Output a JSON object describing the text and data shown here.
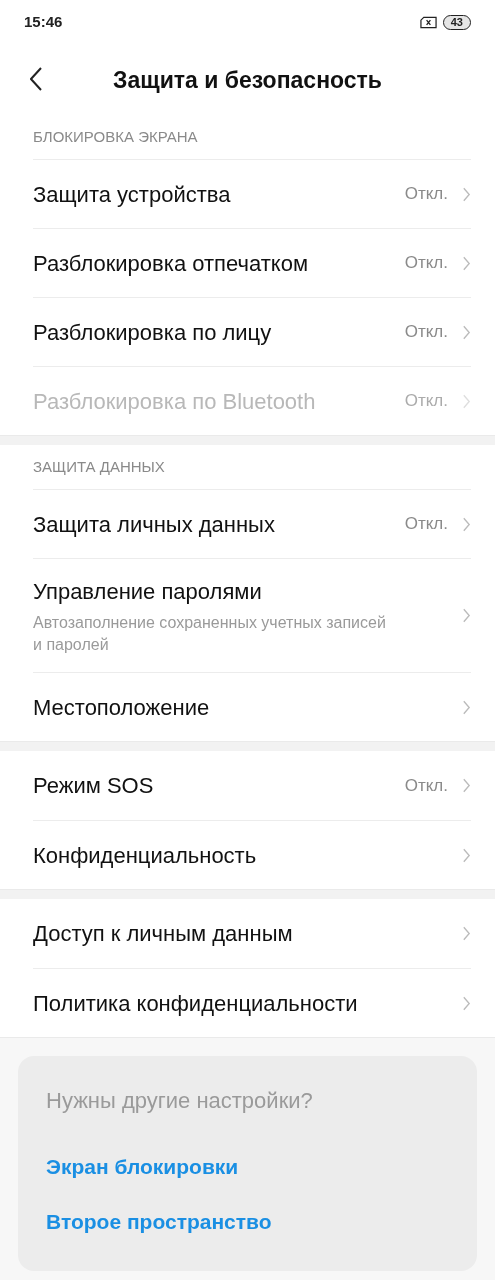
{
  "status_bar": {
    "time": "15:46",
    "battery": "43"
  },
  "header": {
    "title": "Защита и безопасность"
  },
  "sections": [
    {
      "header": "БЛОКИРОВКА ЭКРАНА",
      "items": [
        {
          "title": "Защита устройства",
          "value": "Откл.",
          "disabled": false
        },
        {
          "title": "Разблокировка отпечатком",
          "value": "Откл.",
          "disabled": false
        },
        {
          "title": "Разблокировка по лицу",
          "value": "Откл.",
          "disabled": false
        },
        {
          "title": "Разблокировка по Bluetooth",
          "value": "Откл.",
          "disabled": true
        }
      ]
    },
    {
      "header": "ЗАЩИТА ДАННЫХ",
      "items": [
        {
          "title": "Защита личных данных",
          "value": "Откл.",
          "disabled": false
        },
        {
          "title": "Управление паролями",
          "subtitle": "Автозаполнение сохраненных учетных записей и паролей",
          "disabled": false
        },
        {
          "title": "Местоположение",
          "disabled": false
        }
      ]
    },
    {
      "items": [
        {
          "title": "Режим SOS",
          "value": "Откл.",
          "disabled": false
        },
        {
          "title": "Конфиденциальность",
          "disabled": false
        }
      ]
    },
    {
      "items": [
        {
          "title": "Доступ к личным данным",
          "disabled": false
        },
        {
          "title": "Политика конфиденциальности",
          "disabled": false
        }
      ]
    }
  ],
  "suggestions": {
    "title": "Нужны другие настройки?",
    "links": [
      "Экран блокировки",
      "Второе пространство"
    ]
  }
}
